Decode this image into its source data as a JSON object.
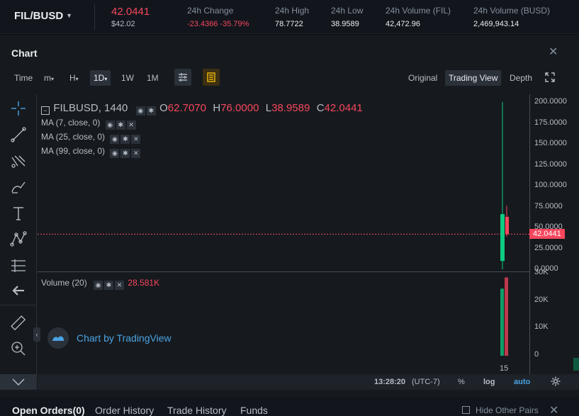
{
  "ticker": {
    "pair": "FIL/BUSD",
    "last_price": "42.0441",
    "usd_price": "$42.02",
    "stats": [
      {
        "label": "24h Change",
        "value": "-23.4366 -35.79%",
        "negative": true
      },
      {
        "label": "24h High",
        "value": "78.7722"
      },
      {
        "label": "24h Low",
        "value": "38.9589"
      },
      {
        "label": "24h Volume (FIL)",
        "value": "42,472.96"
      },
      {
        "label": "24h Volume (BUSD)",
        "value": "2,469,943.14"
      }
    ]
  },
  "chart_header": {
    "title": "Chart",
    "intervals": [
      "Time",
      "m",
      "H",
      "1D",
      "1W",
      "1M"
    ],
    "active_interval": "1D",
    "views": [
      "Original",
      "Trading View",
      "Depth"
    ],
    "active_view": "Trading View"
  },
  "left_tools": [
    "crosshair-icon",
    "trendline-icon",
    "fib-icon",
    "brush-icon",
    "text-icon",
    "pattern-icon",
    "measure-lines-icon",
    "back-arrow-icon",
    "ruler-icon",
    "zoom-in-icon"
  ],
  "legend": {
    "symbol": "FILBUSD, 1440",
    "o_label": "O",
    "o_value": "62.7070",
    "h_label": "H",
    "h_value": "76.0000",
    "l_label": "L",
    "l_value": "38.9589",
    "c_label": "C",
    "c_value": "42.0441",
    "ma": [
      "MA (7, close, 0)",
      "MA (25, close, 0)",
      "MA (99, close, 0)"
    ],
    "volume_label": "Volume (20)",
    "volume_value": "28.581K"
  },
  "chart_data": {
    "type": "candlestick",
    "price_axis_ticks": [
      "200.0000",
      "175.0000",
      "150.0000",
      "125.0000",
      "100.0000",
      "75.0000",
      "50.0000",
      "25.0000",
      "0.0000"
    ],
    "price_axis_range": [
      0,
      200
    ],
    "volume_axis_ticks": [
      "30K",
      "20K",
      "10K",
      "0"
    ],
    "volume_axis_range": [
      0,
      30000
    ],
    "x_tick": "15",
    "candles": [
      {
        "open": 0,
        "high": 200,
        "low": 0,
        "close": 0,
        "color": "#0ecb81",
        "note": "wick"
      },
      {
        "open": 66,
        "high": 66,
        "low": 10,
        "close": 10,
        "color": "#0ecb81"
      },
      {
        "open": 62.707,
        "high": 76,
        "low": 38.9589,
        "close": 42.0441,
        "color": "#f6465d"
      }
    ],
    "volumes": [
      {
        "value": 24500,
        "color": "#0ecb81"
      },
      {
        "value": 28581,
        "color": "#f6465d"
      }
    ],
    "current_price": "42.0441",
    "colors": {
      "up": "#0ecb81",
      "down": "#f6465d"
    }
  },
  "tradingview_credit": "Chart by TradingView",
  "status_bar": {
    "time": "13:28:20",
    "tz": "(UTC-7)",
    "percent": "%",
    "log": "log",
    "auto": "auto"
  },
  "orders_tabs": [
    "Open Orders(0)",
    "Order History",
    "Trade History",
    "Funds"
  ],
  "hide_other_pairs": "Hide Other Pairs"
}
